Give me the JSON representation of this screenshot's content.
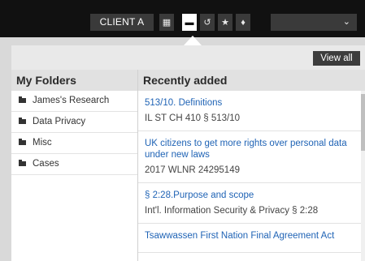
{
  "toolbar": {
    "client_label": "CLIENT A",
    "buttons": [
      {
        "icon": "grid-icon",
        "glyph": "▦"
      },
      {
        "icon": "folder-icon",
        "glyph": "▬",
        "active": true
      },
      {
        "icon": "history-icon",
        "glyph": "↺"
      },
      {
        "icon": "star-icon",
        "glyph": "★"
      },
      {
        "icon": "pin-icon",
        "glyph": "♦"
      }
    ],
    "dropdown": {
      "value": "",
      "icon": "chevron-down-icon"
    }
  },
  "panel": {
    "view_all_label": "View all",
    "my_folders": {
      "title": "My Folders",
      "items": [
        {
          "label": "James's Research"
        },
        {
          "label": "Data Privacy"
        },
        {
          "label": "Misc"
        },
        {
          "label": "Cases"
        }
      ]
    },
    "recently_added": {
      "title": "Recently added",
      "items": [
        {
          "title": "513/10. Definitions",
          "cite": "IL ST CH 410 § 513/10"
        },
        {
          "title": "UK citizens to get more rights over personal data under new laws",
          "cite": "2017 WLNR 24295149"
        },
        {
          "title": "§ 2:28.Purpose and scope",
          "cite": "Int'l. Information Security & Privacy § 2:28"
        },
        {
          "title": "Tsawwassen First Nation Final Agreement Act",
          "cite": ""
        }
      ]
    }
  },
  "colors": {
    "toolbar_bg": "#111111",
    "link": "#1f63b5",
    "header_bg": "#e1e1e1"
  }
}
